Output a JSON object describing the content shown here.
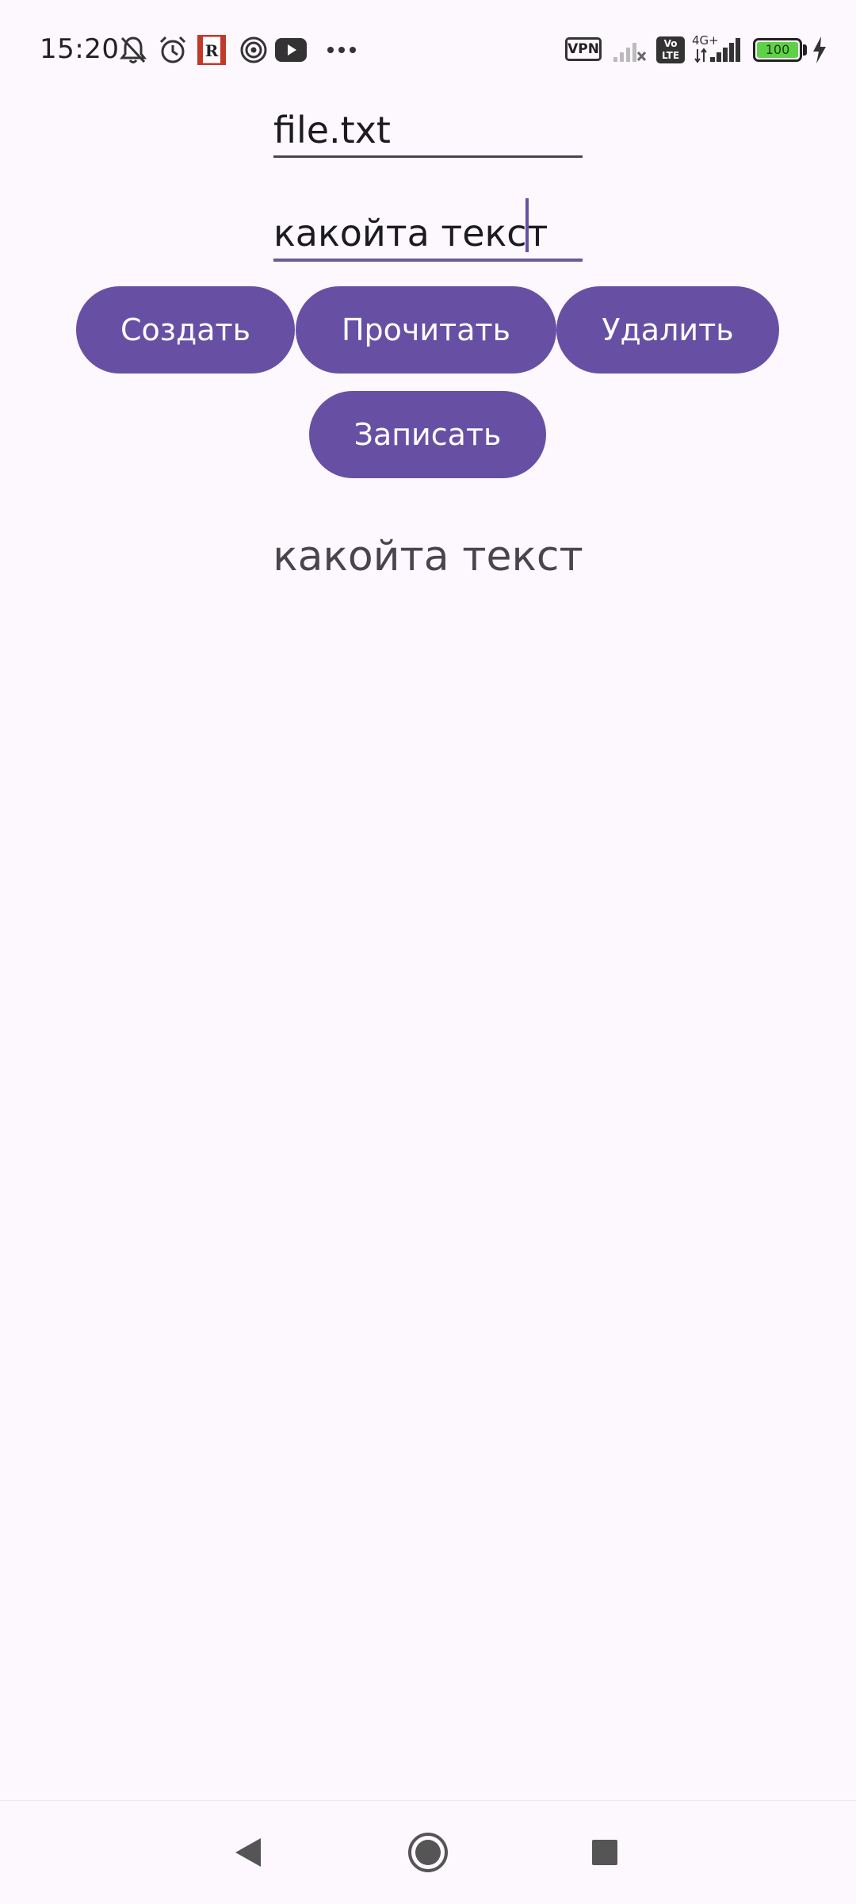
{
  "status_bar": {
    "time": "15:20",
    "vpn_label": "VPN",
    "volte_label": "Vo LTE",
    "network_type": "4G+",
    "battery_level": "100",
    "icons": [
      "bell-off-icon",
      "alarm-icon",
      "app-r-icon",
      "spiral-icon",
      "youtube-icon",
      "more-dots-icon",
      "signal-no-icon",
      "signal-icon",
      "charging-bolt-icon"
    ]
  },
  "form": {
    "filename_value": "file.txt",
    "content_value": "какойта текст"
  },
  "buttons": {
    "create_label": "Создать",
    "read_label": "Прочитать",
    "delete_label": "Удалить",
    "write_label": "Записать"
  },
  "output": {
    "text": "какойта текст"
  },
  "colors": {
    "accent": "#6750a4",
    "background": "#fdf7fe",
    "text": "#1c1b1f",
    "secondary_text": "#49454f",
    "battery": "#5fd148"
  },
  "navigation": {
    "icons": [
      "back-icon",
      "home-icon",
      "recent-apps-icon"
    ]
  }
}
